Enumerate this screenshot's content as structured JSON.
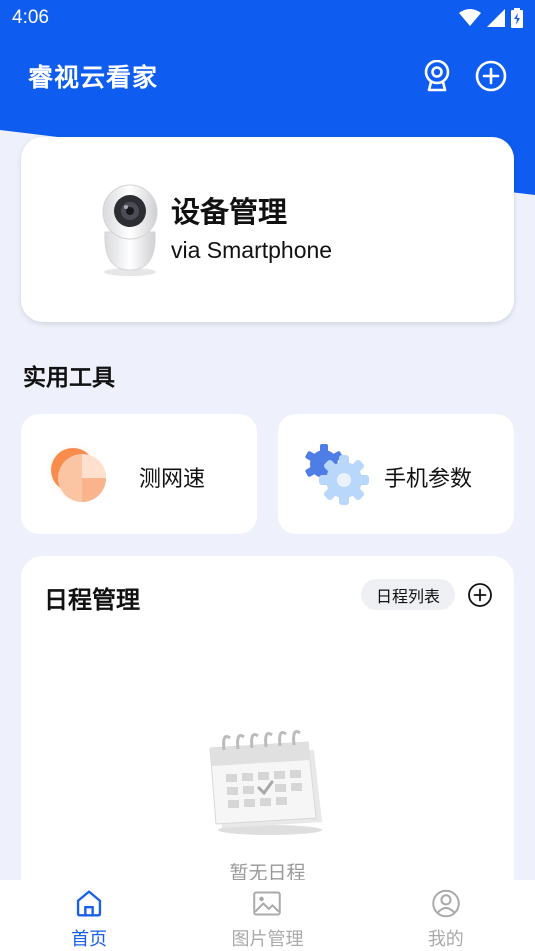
{
  "status_bar": {
    "time": "4:06"
  },
  "header": {
    "title": "睿视云看家"
  },
  "device_card": {
    "title": "设备管理",
    "subtitle": "via Smartphone"
  },
  "tools": {
    "section_title": "实用工具",
    "items": [
      {
        "label": "测网速",
        "icon": "speedometer-icon"
      },
      {
        "label": "手机参数",
        "icon": "gear-icon"
      }
    ]
  },
  "schedule": {
    "title": "日程管理",
    "list_button": "日程列表",
    "empty_text": "暂无日程"
  },
  "bottom_nav": {
    "items": [
      {
        "label": "首页",
        "icon": "home-icon",
        "active": true
      },
      {
        "label": "图片管理",
        "icon": "image-icon",
        "active": false
      },
      {
        "label": "我的",
        "icon": "user-icon",
        "active": false
      }
    ]
  },
  "colors": {
    "primary": "#0f5cf0",
    "active_nav": "#1a5fe8",
    "background": "#eef1fb"
  }
}
